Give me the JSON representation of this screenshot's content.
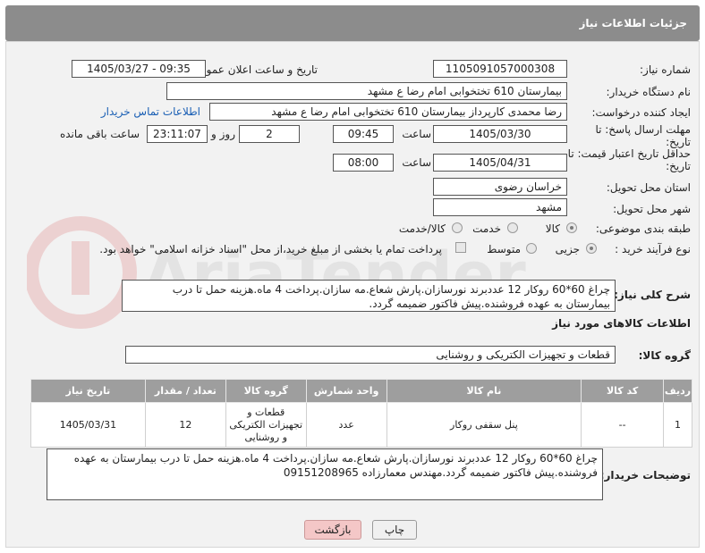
{
  "header": {
    "title": "جزئیات اطلاعات نیاز"
  },
  "fields": {
    "need_number_label": "شماره نیاز:",
    "need_number": "1105091057000308",
    "announce_label": "تاریخ و ساعت اعلان عمومی:",
    "announce_value": "1405/03/27 - 09:35",
    "buyer_org_label": "نام دستگاه خریدار:",
    "buyer_org": "بیمارستان 610 تختخوابی امام رضا ع  مشهد",
    "creator_label": "ایجاد کننده درخواست:",
    "creator": "رضا محمدی کارپرداز بیمارستان 610 تختخوابی امام رضا ع  مشهد",
    "contact_link": "اطلاعات تماس خریدار",
    "deadline_label": "مهلت ارسال پاسخ: تا تاریخ:",
    "deadline_date": "1405/03/30",
    "time_word": "ساعت",
    "deadline_time": "09:45",
    "days_value": "2",
    "days_word": "روز و",
    "remaining_time": "23:11:07",
    "remaining_label": "ساعت باقی مانده",
    "validity_label": "حداقل تاریخ اعتبار قیمت: تا تاریخ:",
    "validity_date": "1405/04/31",
    "validity_time": "08:00",
    "province_label": "استان محل تحویل:",
    "province": "خراسان رضوی",
    "city_label": "شهر محل تحویل:",
    "city": "مشهد",
    "category_label": "طبقه بندی موضوعی:",
    "category_options": [
      "کالا",
      "خدمت",
      "کالا/خدمت"
    ],
    "process_label": "نوع فرآیند خرید :",
    "process_options": [
      "جزیی",
      "متوسط"
    ],
    "payment_note": "پرداخت تمام یا بخشی از مبلغ خرید،از محل \"اسناد خزانه اسلامی\" خواهد بود."
  },
  "description": {
    "label": "شرح کلی نیاز:",
    "text": "چراغ 60*60 روکار 12 عددبرند نورسازان.پارش شعاع.مه سازان.پرداخت 4 ماه.هزینه حمل تا درب بیمارستان به عهده فروشنده.پیش فاکتور ضمیمه گردد."
  },
  "goods": {
    "section_title": "اطلاعات کالاهای مورد نیاز",
    "group_label": "گروه کالا:",
    "group_value": "قطعات و تجهیزات الکتریکی و روشنایی",
    "columns": [
      "ردیف",
      "کد کالا",
      "نام کالا",
      "واحد شمارش",
      "گروه کالا",
      "تعداد / مقدار",
      "تاریخ نیاز"
    ],
    "rows": [
      [
        "1",
        "--",
        "پنل سقفی روکار",
        "عدد",
        "قطعات و تجهیزات الکتریکی و روشنایی",
        "12",
        "1405/03/31"
      ]
    ]
  },
  "buyer_notes": {
    "label": "توضیحات خریدار:",
    "text": "چراغ 60*60 روکار 12 عددبرند نورسازان.پارش شعاع.مه سازان.پرداخت 4 ماه.هزینه حمل تا درب بیمارستان به عهده فروشنده.پیش فاکتور ضمیمه گردد.مهندس معمارزاده 09151208965"
  },
  "buttons": {
    "print": "چاپ",
    "back": "بازگشت"
  },
  "watermark": {
    "text": "AriaTender.neT"
  },
  "colors": {
    "titlebar": "#8c8c8c",
    "table_header": "#9e9e9e",
    "link": "#1a5fb4",
    "back_button": "#f4c7c7"
  }
}
